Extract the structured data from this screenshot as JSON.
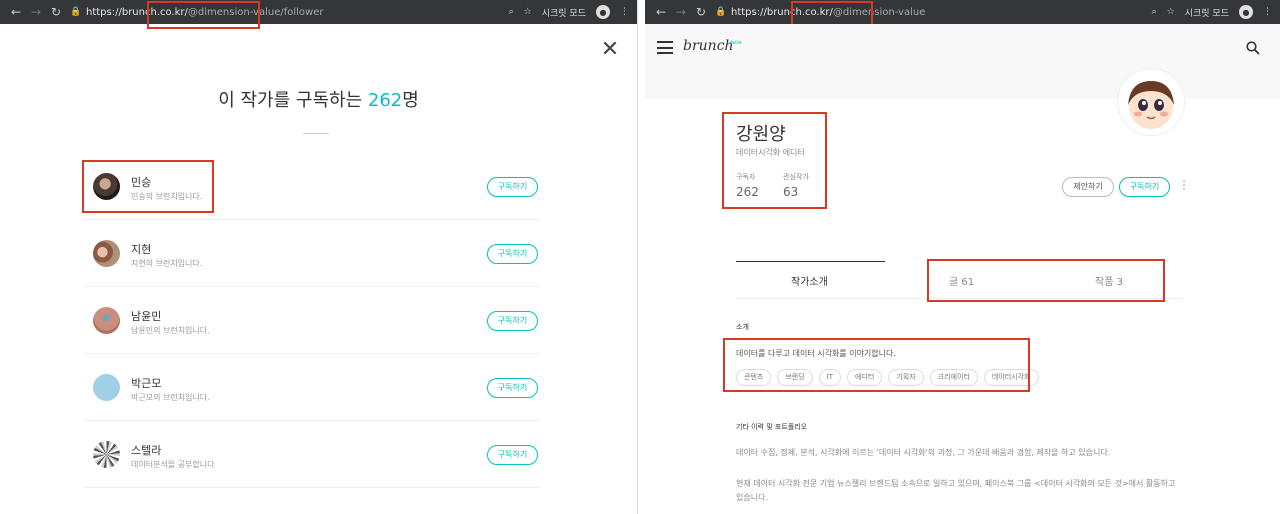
{
  "left_window": {
    "url_host": "https://brunch.co.kr",
    "url_path": "@dimension-value/follower",
    "incognito_label": "시크릿 모드",
    "title_prefix": "이 작가를 구독하는",
    "count": "262",
    "title_suffix": "명",
    "subscribe_label": "구독하기",
    "subscribers": [
      {
        "name": "민승",
        "desc": "민승의 브런치입니다."
      },
      {
        "name": "지현",
        "desc": "지현의 브런치입니다."
      },
      {
        "name": "남윤민",
        "desc": "남윤민의 브런치입니다."
      },
      {
        "name": "박근모",
        "desc": "박근모의 브런치입니다."
      },
      {
        "name": "스텔라",
        "desc": "데이터분석을 공부합니다"
      }
    ]
  },
  "right_window": {
    "url_host": "https://brunch.co.kr",
    "url_path": "@dimension-value",
    "incognito_label": "시크릿 모드",
    "logo": "brunch",
    "logo_badge": "beta",
    "profile": {
      "name": "강원양",
      "job": "데이터시각화 에디터",
      "subscribers_label": "구독자",
      "subscribers_value": "262",
      "following_label": "관심작가",
      "following_value": "63"
    },
    "suggest_label": "제안하기",
    "subscribe_label": "구독하기",
    "tabs": [
      "작가소개",
      "글 61",
      "작품 3"
    ],
    "intro_label": "소개",
    "intro_text": "데이터를 다루고 데이터 시각화를 이야기합니다.",
    "tags": [
      "콘텐츠",
      "브랜딩",
      "IT",
      "에디터",
      "기획자",
      "크리에이터",
      "데이터시각화"
    ],
    "portfolio_label": "기타 이력 및 포트폴리오",
    "portfolio_p1": "데이터 수집, 정제, 분석, 시각화에 이르는 '데이터 시각화'의 과정, 그 가운데 배움과 경험, 제작을 하고 있습니다.",
    "portfolio_p2": "현재 데이터 시각화 전문 기업 뉴스젤리 브랜드팀 소속으로 일하고 있으며, 페이스북 그룹 <데이터 시각화의 모든 것>에서 활동하고 있습니다."
  },
  "colors": {
    "accent": "#00c3bd",
    "highlight": "#d63a23"
  }
}
